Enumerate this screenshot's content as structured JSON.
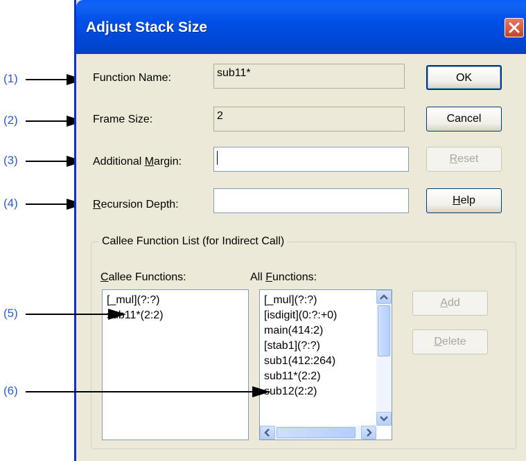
{
  "window": {
    "title": "Adjust Stack Size",
    "close_icon": "close-icon"
  },
  "callouts": [
    "(1)",
    "(2)",
    "(3)",
    "(4)",
    "(5)",
    "(6)"
  ],
  "form": {
    "function_name_label": "Function Name:",
    "function_name_value": "sub11*",
    "frame_size_label": "Frame Size:",
    "frame_size_value": "2",
    "margin_label_pre": "Additional ",
    "margin_label_u": "M",
    "margin_label_post": "argin:",
    "margin_value": "",
    "depth_label_u": "R",
    "depth_label_post": "ecursion Depth:",
    "depth_value": ""
  },
  "buttons": {
    "ok": "OK",
    "cancel": "Cancel",
    "reset_u": "R",
    "reset_post": "eset",
    "help_u": "H",
    "help_post": "elp",
    "add_u": "A",
    "add_post": "dd",
    "delete_u": "D",
    "delete_post": "elete"
  },
  "group": {
    "title": "Callee Function List (for Indirect Call)",
    "callee_label_u": "C",
    "callee_label_post": "allee Functions:",
    "all_label_pre": "All ",
    "all_label_u": "F",
    "all_label_post": "unctions:",
    "callee_items": [
      "[_mul](?:?)",
      "sub11*(2:2)"
    ],
    "all_items": [
      "[_mul](?:?)",
      "[isdigit](0:?:+0)",
      "main(414:2)",
      "[stab1](?:?)",
      "sub1(412:264)",
      "sub11*(2:2)",
      "sub12(2:2)"
    ]
  }
}
